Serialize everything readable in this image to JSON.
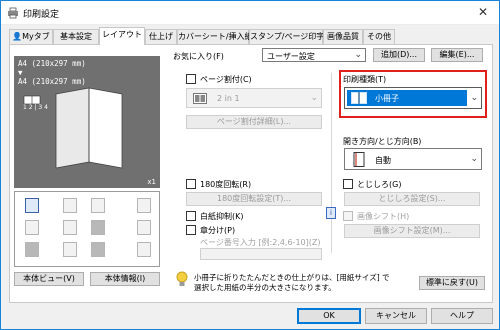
{
  "window": {
    "title": "印刷設定",
    "close_glyph": "✕"
  },
  "tabs": [
    "Myタブ",
    "基本設定",
    "レイアウト",
    "仕上げ",
    "カバーシート/挿入紙",
    "スタンプ/ページ印字",
    "画像品質",
    "その他"
  ],
  "favorites": {
    "label": "お気に入り(F)",
    "value": "ユーザー設定",
    "add_button": "追加(D)...",
    "edit_button": "編集(E)..."
  },
  "preview": {
    "paper_info": "A4 (210x297 mm)\n▼\nA4 (210x297 mm)",
    "page_numbers": "1 2 | 3 4",
    "scale": "x1"
  },
  "preview_buttons": {
    "view": "本体ビュー(V)",
    "info": "本体情報(I)"
  },
  "layout": {
    "combination_label": "ページ割付(C)",
    "combination_value": "2 in 1",
    "combination_details_button": "ページ割付詳細(L)...",
    "rotate_180_label": "180度回転(R)",
    "rotate_180_button": "180度回転設定(T)...",
    "blank_page_label": "白紙抑制(K)",
    "chapter_label": "章分け(P)",
    "chapter_page_label": "ページ番号入力 [例:2,4,6-10](Z)"
  },
  "print_type": {
    "label": "印刷種類(T)",
    "value": "小冊子"
  },
  "binding": {
    "label": "開き方向/とじ方向(B)",
    "value": "自動",
    "staple_label": "とじしろ(G)",
    "staple_button": "とじしろ設定(S)...",
    "shift_label": "画像シフト(H)",
    "shift_button": "画像シフト設定(M)..."
  },
  "hint": {
    "text_line1": "小冊子に折りたたんだときの仕上がりは、[用紙サイズ] で",
    "text_line2": "選択した用紙の半分の大きさになります。",
    "restore_button": "標準に戻す(U)"
  },
  "footer": {
    "ok": "OK",
    "cancel": "キャンセル",
    "help": "ヘルプ"
  },
  "colors": {
    "accent": "#0078d7",
    "highlight_border": "#e0201b",
    "preview_bg": "#707070"
  }
}
